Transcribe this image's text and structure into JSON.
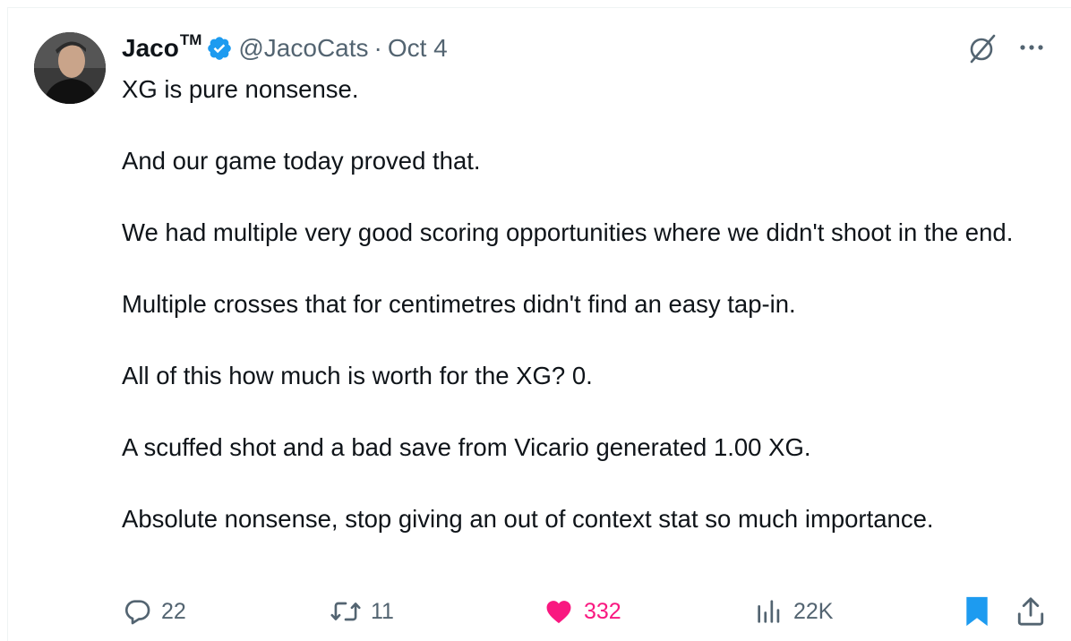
{
  "tweet": {
    "author_name": "Jaco",
    "author_suffix": "TM",
    "handle": "@JacoCats",
    "separator": "·",
    "date": "Oct 4",
    "paragraphs": [
      "XG is pure nonsense.",
      "And our game today proved that.",
      "We had multiple very good scoring opportunities where we didn't shoot in the end.",
      "Multiple crosses that for centimetres didn't find an easy tap-in.",
      "All of this how much is worth for the XG? 0.",
      "A scuffed shot and a bad save from Vicario generated 1.00 XG.",
      "Absolute nonsense, stop giving an out of context stat so much importance."
    ]
  },
  "actions": {
    "replies": "22",
    "retweets": "11",
    "likes": "332",
    "views": "22K"
  },
  "colors": {
    "verified": "#1d9bf0",
    "like": "#f91880",
    "bookmark": "#1d9bf0",
    "muted": "#536471"
  },
  "icons": {
    "header": [
      "verified-badge-icon",
      "grok-icon",
      "more-icon"
    ],
    "actions": [
      "reply-icon",
      "retweet-icon",
      "heart-icon",
      "views-icon",
      "bookmark-icon",
      "share-icon"
    ]
  }
}
